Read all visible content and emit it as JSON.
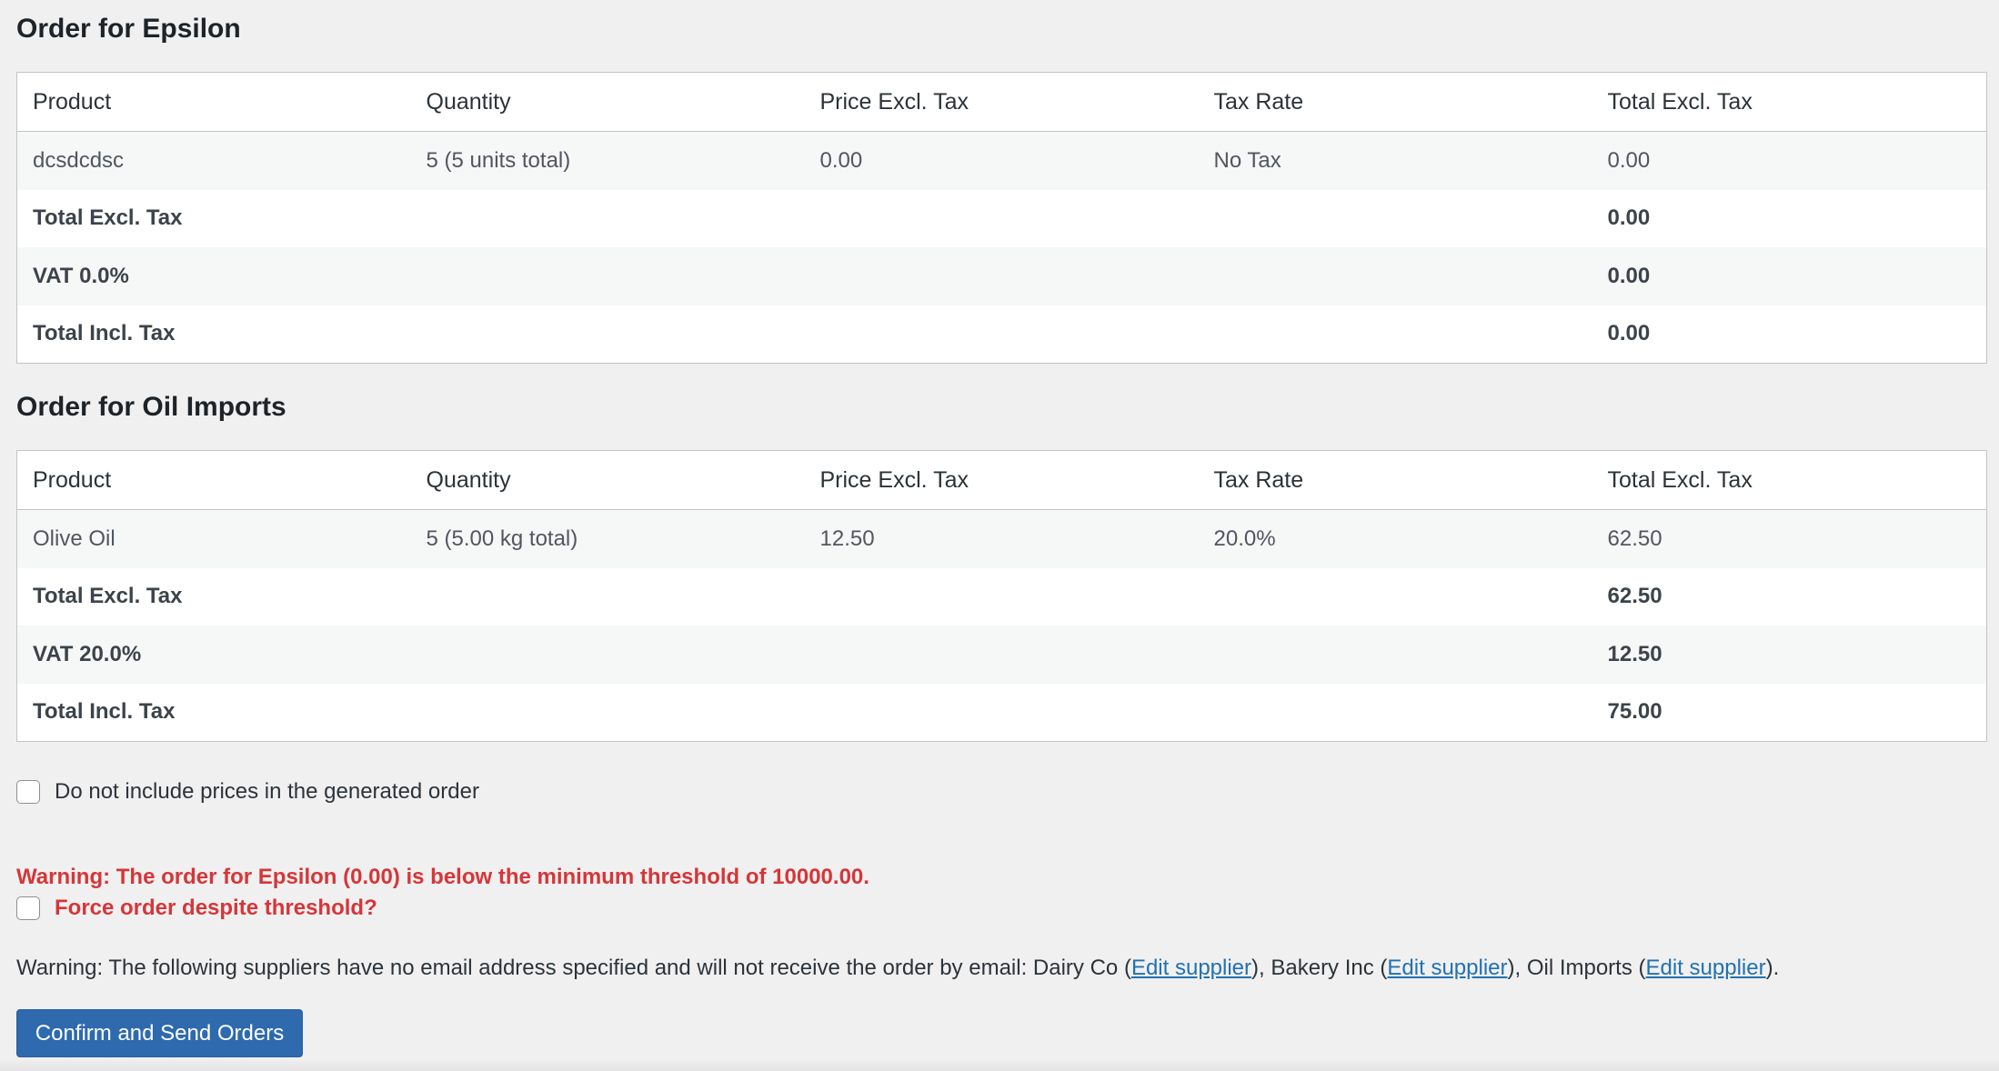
{
  "orders": [
    {
      "title": "Order for Epsilon",
      "headers": [
        "Product",
        "Quantity",
        "Price Excl. Tax",
        "Tax Rate",
        "Total Excl. Tax"
      ],
      "rows": [
        [
          "dcsdcdsc",
          "5 (5 units total)",
          "0.00",
          "No Tax",
          "0.00"
        ]
      ],
      "summary": [
        {
          "label": "Total Excl. Tax",
          "value": "0.00"
        },
        {
          "label": "VAT 0.0%",
          "value": "0.00"
        },
        {
          "label": "Total Incl. Tax",
          "value": "0.00"
        }
      ]
    },
    {
      "title": "Order for Oil Imports",
      "headers": [
        "Product",
        "Quantity",
        "Price Excl. Tax",
        "Tax Rate",
        "Total Excl. Tax"
      ],
      "rows": [
        [
          "Olive Oil",
          "5 (5.00 kg total)",
          "12.50",
          "20.0%",
          "62.50"
        ]
      ],
      "summary": [
        {
          "label": "Total Excl. Tax",
          "value": "62.50"
        },
        {
          "label": "VAT 20.0%",
          "value": "12.50"
        },
        {
          "label": "Total Incl. Tax",
          "value": "75.00"
        }
      ]
    }
  ],
  "options": {
    "no_prices_label": "Do not include prices in the generated order",
    "threshold_warning": "Warning: The order for Epsilon (0.00) is below the minimum threshold of 10000.00.",
    "force_label": "Force order despite threshold?"
  },
  "email_warning": {
    "prefix": "Warning: The following suppliers have no email address specified and will not receive the order by email: ",
    "supplier_1": "Dairy Co",
    "supplier_2": "Bakery Inc",
    "supplier_3": "Oil Imports",
    "open_paren": " (",
    "close_sep": "), ",
    "close_end": ").",
    "edit_link_label": "Edit supplier"
  },
  "actions": {
    "confirm_label": "Confirm and Send Orders"
  },
  "colors": {
    "warning": "#d63638",
    "link": "#2271b1",
    "button": "#2e6aad"
  }
}
